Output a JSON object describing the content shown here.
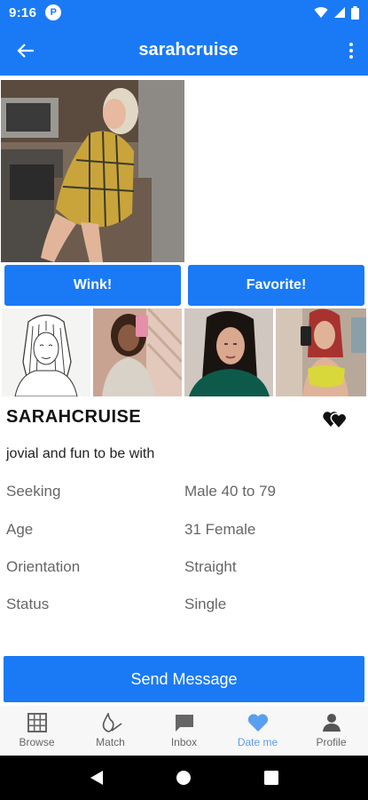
{
  "status_bar": {
    "time": "9:16",
    "app_badge": "P"
  },
  "header": {
    "title": "sarahcruise"
  },
  "actions": {
    "wink_label": "Wink!",
    "favorite_label": "Favorite!"
  },
  "profile": {
    "username": "SARAHCRUISE",
    "tagline": "jovial and fun to be with",
    "details": [
      {
        "label": "Seeking",
        "value": "Male 40 to 79"
      },
      {
        "label": "Age",
        "value": "31 Female"
      },
      {
        "label": "Orientation",
        "value": "Straight"
      },
      {
        "label": "Status",
        "value": "Single"
      }
    ]
  },
  "send_message_label": "Send Message",
  "bottom_nav": {
    "items": [
      {
        "label": "Browse",
        "icon": "grid-icon"
      },
      {
        "label": "Match",
        "icon": "flame-icon"
      },
      {
        "label": "Inbox",
        "icon": "chat-icon"
      },
      {
        "label": "Date me",
        "icon": "heart-icon"
      },
      {
        "label": "Profile",
        "icon": "person-icon"
      }
    ],
    "active": "Date me"
  },
  "colors": {
    "primary": "#1a7af5",
    "active_nav": "#5a9ef0"
  }
}
